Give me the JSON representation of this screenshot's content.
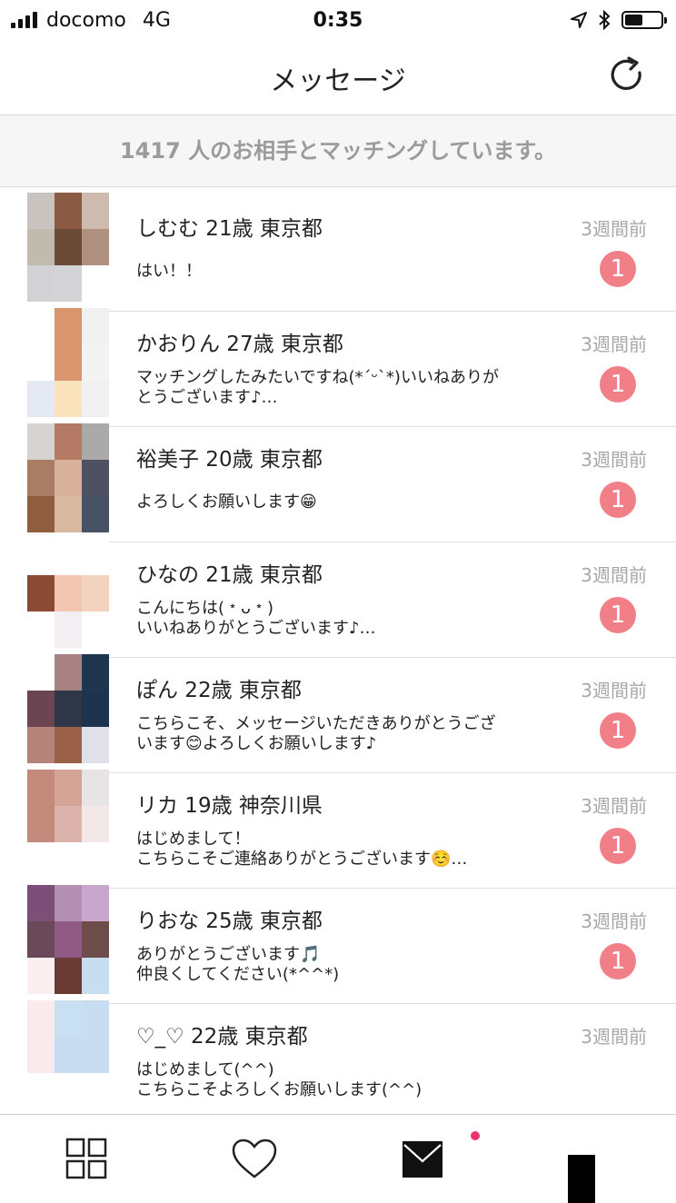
{
  "status_bar": {
    "carrier": "docomo",
    "network": "4G",
    "time": "0:35",
    "battery_level": 0.5
  },
  "nav": {
    "title": "メッセージ"
  },
  "banner": {
    "text": "1417 人のお相手とマッチングしています。"
  },
  "colors": {
    "badge": "#f07f88",
    "notification_dot": "#e8366a",
    "muted_text": "#a8a8a8"
  },
  "conversations": [
    {
      "name": "しむむ 21歳 東京都",
      "time": "3週間前",
      "message": "はい！！",
      "unread": "1",
      "avatar_colors": [
        "#c8c3bf",
        "#8a5a44",
        "#cdbbb0",
        "#c0bbae",
        "#6b4a38",
        "#b09080",
        "#d2d1d3",
        "#d4d3d6",
        "#ffffff"
      ]
    },
    {
      "name": "かおりん 27歳 東京都",
      "time": "3週間前",
      "message": "マッチングしたみたいですね(*´ᵕ`*)いいねありが\nとうございます♪…",
      "unread": "1",
      "avatar_colors": [
        "#ffffff",
        "#d9956e",
        "#f1f1f1",
        "#ffffff",
        "#d9956e",
        "#f3f3f3",
        "#e5eaf2",
        "#fbe3bd",
        "#f0f0f0"
      ]
    },
    {
      "name": "裕美子 20歳 東京都",
      "time": "3週間前",
      "message": "よろしくお願いします😁",
      "unread": "1",
      "avatar_colors": [
        "#d6d4d0",
        "#b47a65",
        "#acaaa8",
        "#a97c64",
        "#d8b19b",
        "#4d5161",
        "#8e5e3f",
        "#d9b8a0",
        "#475266"
      ]
    },
    {
      "name": "ひなの 21歳 東京都",
      "time": "3週間前",
      "message": "こんにちは(﹡ᴗ﹡)\nいいねありがとうございます♪…",
      "unread": "1",
      "avatar_colors": [
        "#ffffff",
        "#ffffff",
        "#ffffff",
        "#8a4a34",
        "#f2c6b0",
        "#f4d2c0",
        "#ffffff",
        "#f3eef1",
        "#ffffff"
      ]
    },
    {
      "name": "ぽん 22歳 東京都",
      "time": "3週間前",
      "message": "こちらこそ、メッセージいただきありがとうござ\nいます😊よろしくお願いします♪",
      "unread": "1",
      "avatar_colors": [
        "#ffffff",
        "#a98284",
        "#1f3550",
        "#6c4552",
        "#2e3648",
        "#1d3350",
        "#b5837a",
        "#9a6048",
        "#e0e0e8"
      ]
    },
    {
      "name": "リカ 19歳 神奈川県",
      "time": "3週間前",
      "message": "はじめまして！\nこちらこそご連絡ありがとうございます☺️…",
      "unread": "1",
      "avatar_colors": [
        "#c48a7c",
        "#d4a596",
        "#e8e4e6",
        "#c48a7c",
        "#dcb3ac",
        "#f3e8e8",
        "#ffffff",
        "#ffffff",
        "#ffffff"
      ]
    },
    {
      "name": "りおな 25歳 東京都",
      "time": "3週間前",
      "message": "ありがとうございます🎵\n仲良くしてください(*^^*)",
      "unread": "1",
      "avatar_colors": [
        "#7b4f78",
        "#b48fb4",
        "#c9a6cd",
        "#6a4a58",
        "#8f5a84",
        "#6e4c4a",
        "#fceff0",
        "#6a3b35",
        "#c7ddf0"
      ]
    },
    {
      "name": "♡_♡ 22歳 東京都",
      "time": "3週間前",
      "message": "はじめまして(^^)\nこちらこそよろしくお願いします(^^)",
      "unread": "",
      "avatar_colors": [
        "#fbeaec",
        "#c9e0f3",
        "#c9ddf2",
        "#fbeaec",
        "#c9ddf2",
        "#c9ddf2",
        "#ffffff",
        "#ffffff",
        "#ffffff"
      ]
    }
  ],
  "tabbar": {
    "icons": [
      "grid-icon",
      "heart-icon",
      "mail-icon",
      "profile-icon"
    ]
  }
}
